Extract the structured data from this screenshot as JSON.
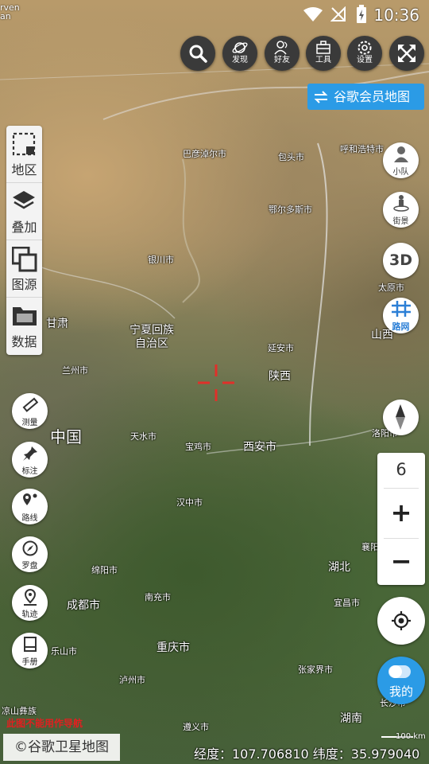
{
  "status": {
    "time": "10:36",
    "corner_text_1": "rven",
    "corner_text_2": "an"
  },
  "top_toolbar": {
    "search_label": "",
    "discover_label": "发现",
    "friends_label": "好友",
    "tools_label": "工具",
    "settings_label": "设置"
  },
  "vip_button": {
    "label": "谷歌会员地图"
  },
  "left_panel": {
    "region_label": "地区",
    "overlay_label": "叠加",
    "source_label": "图源",
    "data_label": "数据"
  },
  "left_tools": {
    "measure_label": "测量",
    "mark_label": "标注",
    "route_label": "路线",
    "compass_label": "罗盘",
    "track_label": "轨迹",
    "manual_label": "手册"
  },
  "right_tools": {
    "team_label": "小队",
    "street_label": "街景",
    "threed_label": "3D",
    "roadnet_label": "路网",
    "zoom_level": "6",
    "zoom_in": "+",
    "zoom_out": "−",
    "me_label": "我的"
  },
  "map_labels": {
    "bayannaoer": "巴彦淖尔市",
    "baotou": "包头市",
    "hohhot": "呼和浩特市",
    "ordos": "鄂尔多斯市",
    "yinchuan": "银川市",
    "gansu": "甘肃",
    "ningxia_1": "宁夏回族",
    "ningxia_2": "自治区",
    "yanan": "延安市",
    "taiyuan": "太原市",
    "shanxi": "山西",
    "lanzhou": "兰州市",
    "shaanxi": "陕西",
    "china": "中国",
    "tianshui": "天水市",
    "baoji": "宝鸡市",
    "xian": "西安市",
    "luoyang": "洛阳市",
    "hanzhong": "汉中市",
    "mianyang": "绵阳市",
    "hubei": "湖北",
    "xiangyang": "襄阳市",
    "nanchong": "南充市",
    "chengdu": "成都市",
    "yichang": "宜昌市",
    "chongqing": "重庆市",
    "leshan": "乐山市",
    "luzhou": "泸州市",
    "zhangjiajie": "张家界市",
    "changsha": "长沙市",
    "hunan": "湖南",
    "liangshan": "凉山彝族",
    "zunyi": "遵义市"
  },
  "footer": {
    "brand": "©谷歌卫星地图",
    "coords": "经度：107.706810 纬度：35.979040",
    "warning": "此图不能用作导航",
    "scale": "100 km"
  },
  "colors": {
    "accent": "#2b9be6",
    "crosshair": "#e0302a",
    "toolbar_dark": "#3a3a3a"
  }
}
